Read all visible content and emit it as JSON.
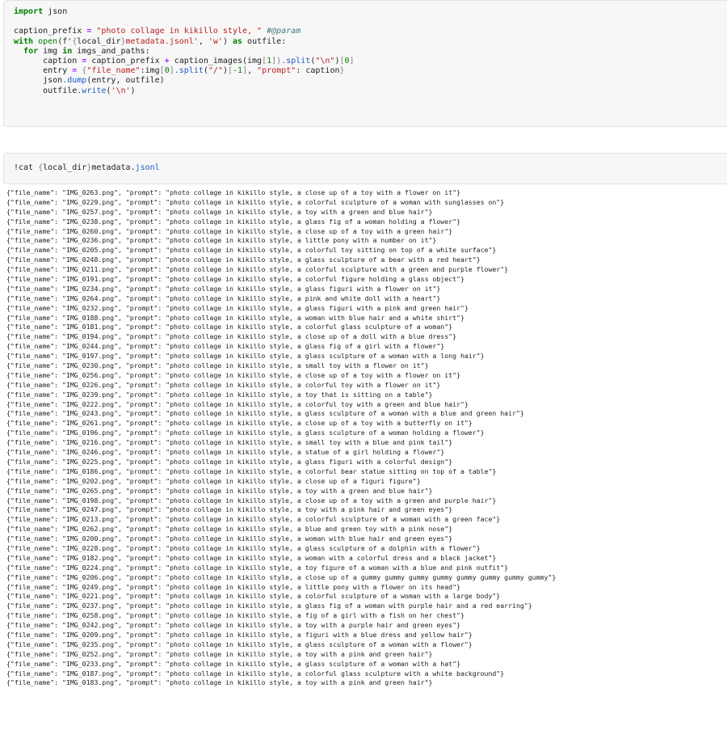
{
  "cell1": {
    "l1": {
      "kw": "import",
      "rest": " json"
    },
    "l3": {
      "var": "caption_prefix ",
      "op": "=",
      "str": " \"photo collage in kikillo style, \"",
      "cm": " #@param"
    },
    "l4": {
      "kw1": "with",
      "bi": " open",
      "p1": "(f'",
      "br1": "{",
      "var": "local_dir",
      "br2": "}",
      "str": "metadata.jsonl'",
      "p2": ", ",
      "str2": "'w'",
      "p3": ") ",
      "kw2": "as",
      "rest": " outfile:"
    },
    "l5": {
      "ind": "  ",
      "kw1": "for",
      "v1": " img ",
      "kw2": "in",
      "rest": " imgs_and_paths:"
    },
    "l6": {
      "ind": "      ",
      "v1": "caption ",
      "op1": "=",
      "v2": " caption_prefix ",
      "op2": "+",
      "v3": " caption_images(img",
      "br1": "[",
      "n1": "1",
      "br2": "])",
      "at": ".split",
      "p1": "(",
      "str": "\"\\n\"",
      "p2": ")",
      "br3": "[",
      "n2": "0",
      "br4": "]"
    },
    "l7": {
      "ind": "      ",
      "v1": "entry ",
      "op1": "=",
      "br1": " {",
      "s1": "\"file_name\"",
      "p1": ":img",
      "br2": "[",
      "n1": "0",
      "br3": "]",
      "at": ".split",
      "p2": "(",
      "s2": "\"/\"",
      "p3": ")",
      "br4": "[",
      "n2": "-1",
      "br5": "]",
      "p4": ", ",
      "s3": "\"prompt\"",
      "p5": ": caption",
      "br6": "}"
    },
    "l8": {
      "ind": "      ",
      "v1": "json",
      "at": ".dump",
      "rest": "(entry, outfile)"
    },
    "l9": {
      "ind": "      ",
      "v1": "outfile",
      "at": ".write",
      "p1": "(",
      "str": "'\\n'",
      "p2": ")"
    }
  },
  "cell2": {
    "p1": "!cat ",
    "br1": "{",
    "v": "local_dir",
    "br2": "}",
    "rest": "metadata.",
    "at": "jsonl"
  },
  "output": [
    {
      "file": "IMG_0263.png",
      "caption": "a close up of a toy with a flower on it"
    },
    {
      "file": "IMG_0229.png",
      "caption": "a colorful sculpture of a woman with sunglasses on"
    },
    {
      "file": "IMG_0257.png",
      "caption": "a toy with a green and blue hair"
    },
    {
      "file": "IMG_0238.png",
      "caption": "a glass fig of a woman holding a flower"
    },
    {
      "file": "IMG_0260.png",
      "caption": "a close up of a toy with a green hair"
    },
    {
      "file": "IMG_0236.png",
      "caption": "a little pony with a number on it"
    },
    {
      "file": "IMG_0205.png",
      "caption": "a colorful toy sitting on top of a white surface"
    },
    {
      "file": "IMG_0248.png",
      "caption": "a glass sculpture of a bear with a red heart"
    },
    {
      "file": "IMG_0211.png",
      "caption": "a colorful sculpture with a green and purple flower"
    },
    {
      "file": "IMG_0191.png",
      "caption": "a colorful figure holding a glass object"
    },
    {
      "file": "IMG_0234.png",
      "caption": "a glass figuri with a flower on it"
    },
    {
      "file": "IMG_0264.png",
      "caption": "a pink and white doll with a heart"
    },
    {
      "file": "IMG_0232.png",
      "caption": "a glass figuri with a pink and green hair"
    },
    {
      "file": "IMG_0188.png",
      "caption": "a woman with blue hair and a white shirt"
    },
    {
      "file": "IMG_0181.png",
      "caption": "a colorful glass sculpture of a woman"
    },
    {
      "file": "IMG_0194.png",
      "caption": "a close up of a doll with a blue dress"
    },
    {
      "file": "IMG_0244.png",
      "caption": "a glass fig of a girl with a flower"
    },
    {
      "file": "IMG_0197.png",
      "caption": "a glass sculpture of a woman with a long hair"
    },
    {
      "file": "IMG_0230.png",
      "caption": "a small toy with a flower on it"
    },
    {
      "file": "IMG_0256.png",
      "caption": "a close up of a toy with a flower on it"
    },
    {
      "file": "IMG_0226.png",
      "caption": "a colorful toy with a flower on it"
    },
    {
      "file": "IMG_0239.png",
      "caption": "a toy that is sitting on a table"
    },
    {
      "file": "IMG_0222.png",
      "caption": "a colorful toy with a green and blue hair"
    },
    {
      "file": "IMG_0243.png",
      "caption": "a glass sculpture of a woman with a blue and green hair"
    },
    {
      "file": "IMG_0261.png",
      "caption": "a close up of a toy with a butterfly on it"
    },
    {
      "file": "IMG_0196.png",
      "caption": "a glass sculpture of a woman holding a flower"
    },
    {
      "file": "IMG_0216.png",
      "caption": "a small toy with a blue and pink tail"
    },
    {
      "file": "IMG_0246.png",
      "caption": "a statue of a girl holding a flower"
    },
    {
      "file": "IMG_0225.png",
      "caption": "a glass figuri with a colorful design"
    },
    {
      "file": "IMG_0186.png",
      "caption": "a colorful bear statue sitting on top of a table"
    },
    {
      "file": "IMG_0202.png",
      "caption": "a close up of a figuri figure"
    },
    {
      "file": "IMG_0265.png",
      "caption": "a toy with a green and blue hair"
    },
    {
      "file": "IMG_0198.png",
      "caption": "a close up of a toy with a green and purple hair"
    },
    {
      "file": "IMG_0247.png",
      "caption": "a toy with a pink hair and green eyes"
    },
    {
      "file": "IMG_0213.png",
      "caption": "a colorful sculpture of a woman with a green face"
    },
    {
      "file": "IMG_0262.png",
      "caption": "a blue and green toy with a pink nose"
    },
    {
      "file": "IMG_0200.png",
      "caption": "a woman with blue hair and green eyes"
    },
    {
      "file": "IMG_0228.png",
      "caption": "a glass sculpture of a dolphin with a flower"
    },
    {
      "file": "IMG_0182.png",
      "caption": "a woman with a colorful dress and a black jacket"
    },
    {
      "file": "IMG_0224.png",
      "caption": "a toy figure of a woman with a blue and pink outfit"
    },
    {
      "file": "IMG_0206.png",
      "caption": "a close up of a gummy gummy gummy gummy gummy gummy gummy gummy"
    },
    {
      "file": "IMG_0249.png",
      "caption": "a little pony with a flower on its head"
    },
    {
      "file": "IMG_0221.png",
      "caption": "a colorful sculpture of a woman with a large body"
    },
    {
      "file": "IMG_0237.png",
      "caption": "a glass fig of a woman with purple hair and a red earring"
    },
    {
      "file": "IMG_0258.png",
      "caption": "a fig of a girl with a fish on her chest"
    },
    {
      "file": "IMG_0242.png",
      "caption": "a toy with a purple hair and green eyes"
    },
    {
      "file": "IMG_0209.png",
      "caption": "a figuri with a blue dress and yellow hair"
    },
    {
      "file": "IMG_0235.png",
      "caption": "a glass sculpture of a woman with a flower"
    },
    {
      "file": "IMG_0252.png",
      "caption": "a toy with a pink and green hair"
    },
    {
      "file": "IMG_0233.png",
      "caption": "a glass sculpture of a woman with a hat"
    },
    {
      "file": "IMG_0187.png",
      "caption": "a colorful glass sculpture with a white background"
    },
    {
      "file": "IMG_0183.png",
      "caption": "a toy with a pink and green hair"
    }
  ]
}
